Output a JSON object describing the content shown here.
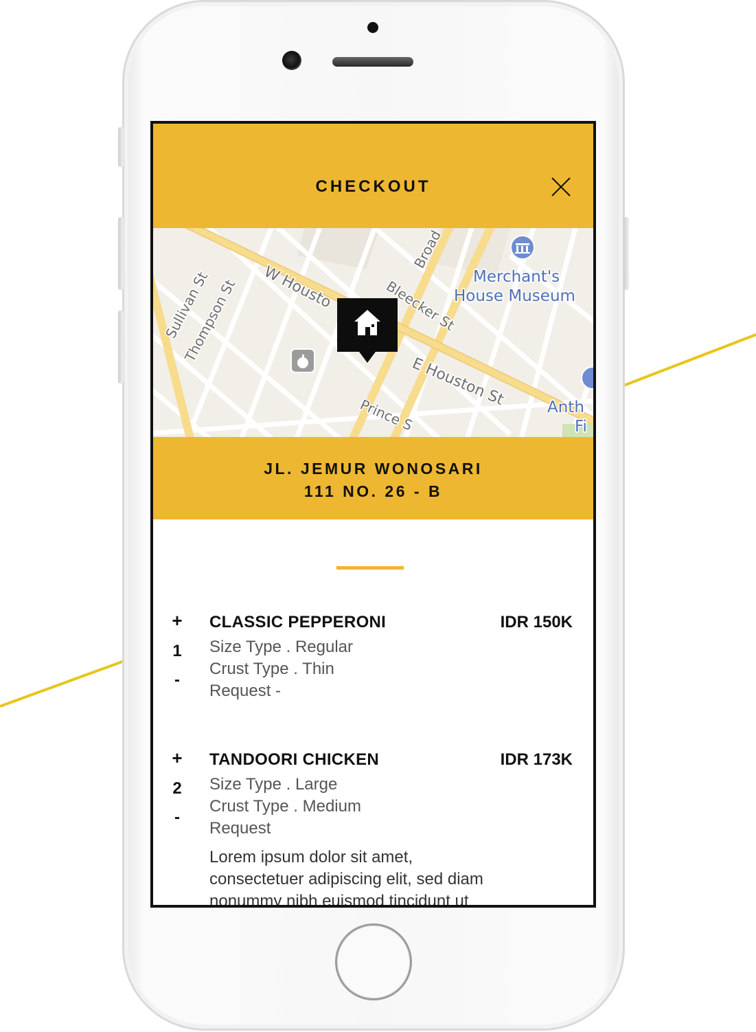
{
  "header": {
    "title": "CHECKOUT",
    "close_icon": "close-icon"
  },
  "map": {
    "labels": {
      "street_w_houston": "W Housto",
      "street_e_houston": "E Houston St",
      "street_bleecker": "Bleecker St",
      "street_broadway": "Broad",
      "street_sullivan": "Sullivan St",
      "street_thompson": "Thompson St",
      "street_prince": "Prince S",
      "museum_line1": "Merchant's",
      "museum_line2": "House Museum",
      "cut_label_line1": "Anth",
      "cut_label_line2": "Fi"
    },
    "marker_icon": "home-icon",
    "poi_icon": "apple-store-icon",
    "museum_icon": "museum-icon"
  },
  "address": {
    "line1": "JL. JEMUR WONOSARI",
    "line2": "111 NO. 26 - B"
  },
  "items": [
    {
      "plus": "+",
      "qty": "1",
      "minus": "-",
      "name": "CLASSIC PEPPERONI",
      "price": "IDR 150K",
      "size": "Size Type . Regular",
      "crust": "Crust Type . Thin",
      "request": "Request -"
    },
    {
      "plus": "+",
      "qty": "2",
      "minus": "-",
      "name": "TANDOORI CHICKEN",
      "price": "IDR 173K",
      "size": "Size Type . Large",
      "crust": "Crust Type . Medium",
      "request": "Request",
      "request_text_1": "Lorem ipsum dolor sit amet,",
      "request_text_2": "consectetuer adipiscing elit, sed diam",
      "request_text_3": "nonummy nibh euismod tincidunt ut"
    }
  ],
  "colors": {
    "accent": "#eeb731",
    "deco_line": "#e8c51a",
    "text": "#111111"
  }
}
